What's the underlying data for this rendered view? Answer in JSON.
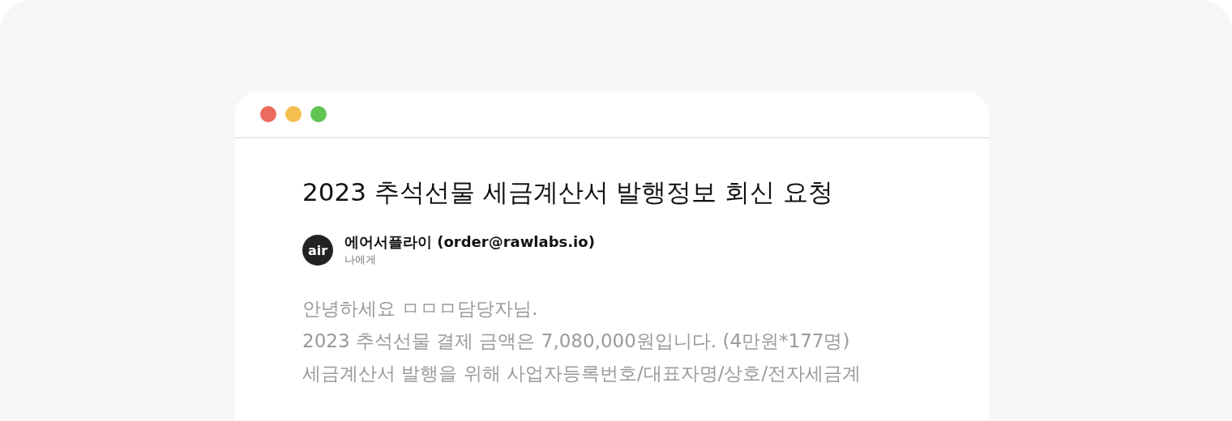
{
  "email": {
    "subject": "2023 추석선물 세금계산서 발행정보 회신 요청",
    "sender": {
      "avatar_label": "air",
      "name": "에어서플라이 (order@rawlabs.io)",
      "recipient": "나에게"
    },
    "body_lines": [
      "안녕하세요 ㅁㅁㅁ담당자님.",
      "2023 추석선물 결제 금액은 7,080,000원입니다. (4만원*177명)",
      "세금계산서 발행을 위해 사업자등록번호/대표자명/상호/전자세금계"
    ]
  }
}
